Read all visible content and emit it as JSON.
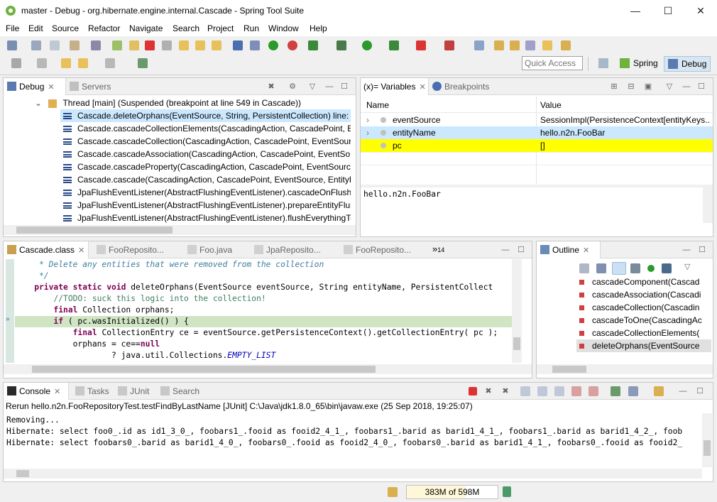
{
  "window": {
    "title": "master - Debug - org.hibernate.engine.internal.Cascade - Spring Tool Suite",
    "minimize": "—",
    "maximize": "☐",
    "close": "✕"
  },
  "menu": [
    "File",
    "Edit",
    "Source",
    "Refactor",
    "Navigate",
    "Search",
    "Project",
    "Run",
    "Window",
    "Help"
  ],
  "toolbar": {
    "quick_access_placeholder": "Quick Access",
    "perspective_spring": "Spring",
    "perspective_debug": "Debug"
  },
  "debug_view": {
    "tabs": [
      "Debug",
      "Servers"
    ],
    "thread": "Thread [main] (Suspended (breakpoint at line 549 in Cascade))",
    "frames": [
      "Cascade.deleteOrphans(EventSource, String, PersistentCollection) line: 5",
      "Cascade.cascadeCollectionElements(CascadingAction, CascadePoint, E",
      "Cascade.cascadeCollection(CascadingAction, CascadePoint, EventSour",
      "Cascade.cascadeAssociation(CascadingAction, CascadePoint, EventSou",
      "Cascade.cascadeProperty(CascadingAction, CascadePoint, EventSource",
      "Cascade.cascade(CascadingAction, CascadePoint, EventSource, EntityP",
      "JpaFlushEventListener(AbstractFlushingEventListener).cascadeOnFlush(",
      "JpaFlushEventListener(AbstractFlushingEventListener).prepareEntityFlus",
      "JpaFlushEventListener(AbstractFlushingEventListener).flushEverythingTo"
    ]
  },
  "variables_view": {
    "tabs": [
      "(x)= Variables",
      "Breakpoints"
    ],
    "columns": [
      "Name",
      "Value"
    ],
    "rows": [
      {
        "name": "eventSource",
        "value": "SessionImpl(PersistenceContext[entityKeys..."
      },
      {
        "name": "entityName",
        "value": "hello.n2n.FooBar"
      },
      {
        "name": "pc",
        "value": "[]"
      }
    ],
    "detail": "hello.n2n.FooBar"
  },
  "editor": {
    "tabs": [
      "Cascade.class",
      "FooReposito...",
      "Foo.java",
      "JpaReposito...",
      "FooReposito..."
    ],
    "overflow": "»",
    "overflow_count": "14",
    "lines": {
      "l1": "     * Delete any entities that were removed from the collection",
      "l2": "     */",
      "l3_a": "    private static void ",
      "l3_b": "deleteOrphans(EventSource eventSource, String entityName, PersistentCollect",
      "l4": "        //TODO: suck this logic into the collection!",
      "l5_a": "        final ",
      "l5_b": "Collection orphans;",
      "l6_a": "        if ",
      "l6_b": "( pc.wasInitialized() ) {",
      "l7_a": "            final ",
      "l7_b": "CollectionEntry ce = eventSource.getPersistenceContext().getCollectionEntry( pc );",
      "l8_a": "            orphans = ce==",
      "l8_b": "null",
      "l9_a": "                    ? java.util.Collections.",
      "l9_b": "EMPTY_LIST"
    }
  },
  "outline_view": {
    "tab": "Outline",
    "items": [
      "cascadeComponent(Cascad",
      "cascadeAssociation(Cascadi",
      "cascadeCollection(Cascadin",
      "cascadeToOne(CascadingAc",
      "cascadeCollectionElements(",
      "deleteOrphans(EventSource"
    ]
  },
  "console_view": {
    "tabs": [
      "Console",
      "Tasks",
      "JUnit",
      "Search"
    ],
    "header": "Rerun hello.n2n.FooRepositoryTest.testFindByLastName [JUnit] C:\\Java\\jdk1.8.0_65\\bin\\javaw.exe (25 Sep 2018, 19:25:07)",
    "lines": [
      "Removing...",
      "Hibernate: select foo0_.id as id1_3_0_, foobars1_.fooid as fooid2_4_1_, foobars1_.barid as barid1_4_1_, foobars1_.barid as barid1_4_2_, foob",
      "Hibernate: select foobars0_.barid as barid1_4_0_, foobars0_.fooid as fooid2_4_0_, foobars0_.barid as barid1_4_1_, foobars0_.fooid as fooid2_"
    ]
  },
  "status": {
    "heap": "383M of 598M"
  },
  "colors": {
    "highlight_yellow": "#ffff00",
    "selection_blue": "#cce8ff",
    "current_line_green": "#cfe5c3"
  }
}
